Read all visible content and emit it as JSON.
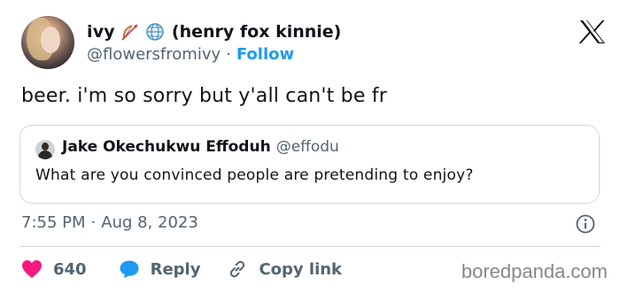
{
  "author": {
    "display_name": "ivy",
    "display_name_suffix": "(henry fox kinnie)",
    "name_emojis": [
      "bow-and-arrow-emoji",
      "globe-emoji"
    ],
    "handle": "@flowersfromivy",
    "separator": "·",
    "follow_label": "Follow"
  },
  "platform_icon": "x-logo-icon",
  "tweet": {
    "text": "beer. i'm so sorry but y'all can't be fr"
  },
  "quoted_tweet": {
    "author_name": "Jake Okechukwu Effoduh",
    "author_handle": "@effodu",
    "text": "What are you convinced people are pretending to enjoy?"
  },
  "meta": {
    "time": "7:55 PM",
    "separator": "·",
    "date": "Aug 8, 2023",
    "info_icon": "info-icon"
  },
  "actions": {
    "like_count": "640",
    "reply_label": "Reply",
    "copy_label": "Copy link"
  },
  "watermark": "boredpanda.com",
  "colors": {
    "accent": "#1d9bf0",
    "like": "#f91880",
    "text": "#0f1419",
    "muted": "#536471",
    "border": "#cfd9de"
  }
}
